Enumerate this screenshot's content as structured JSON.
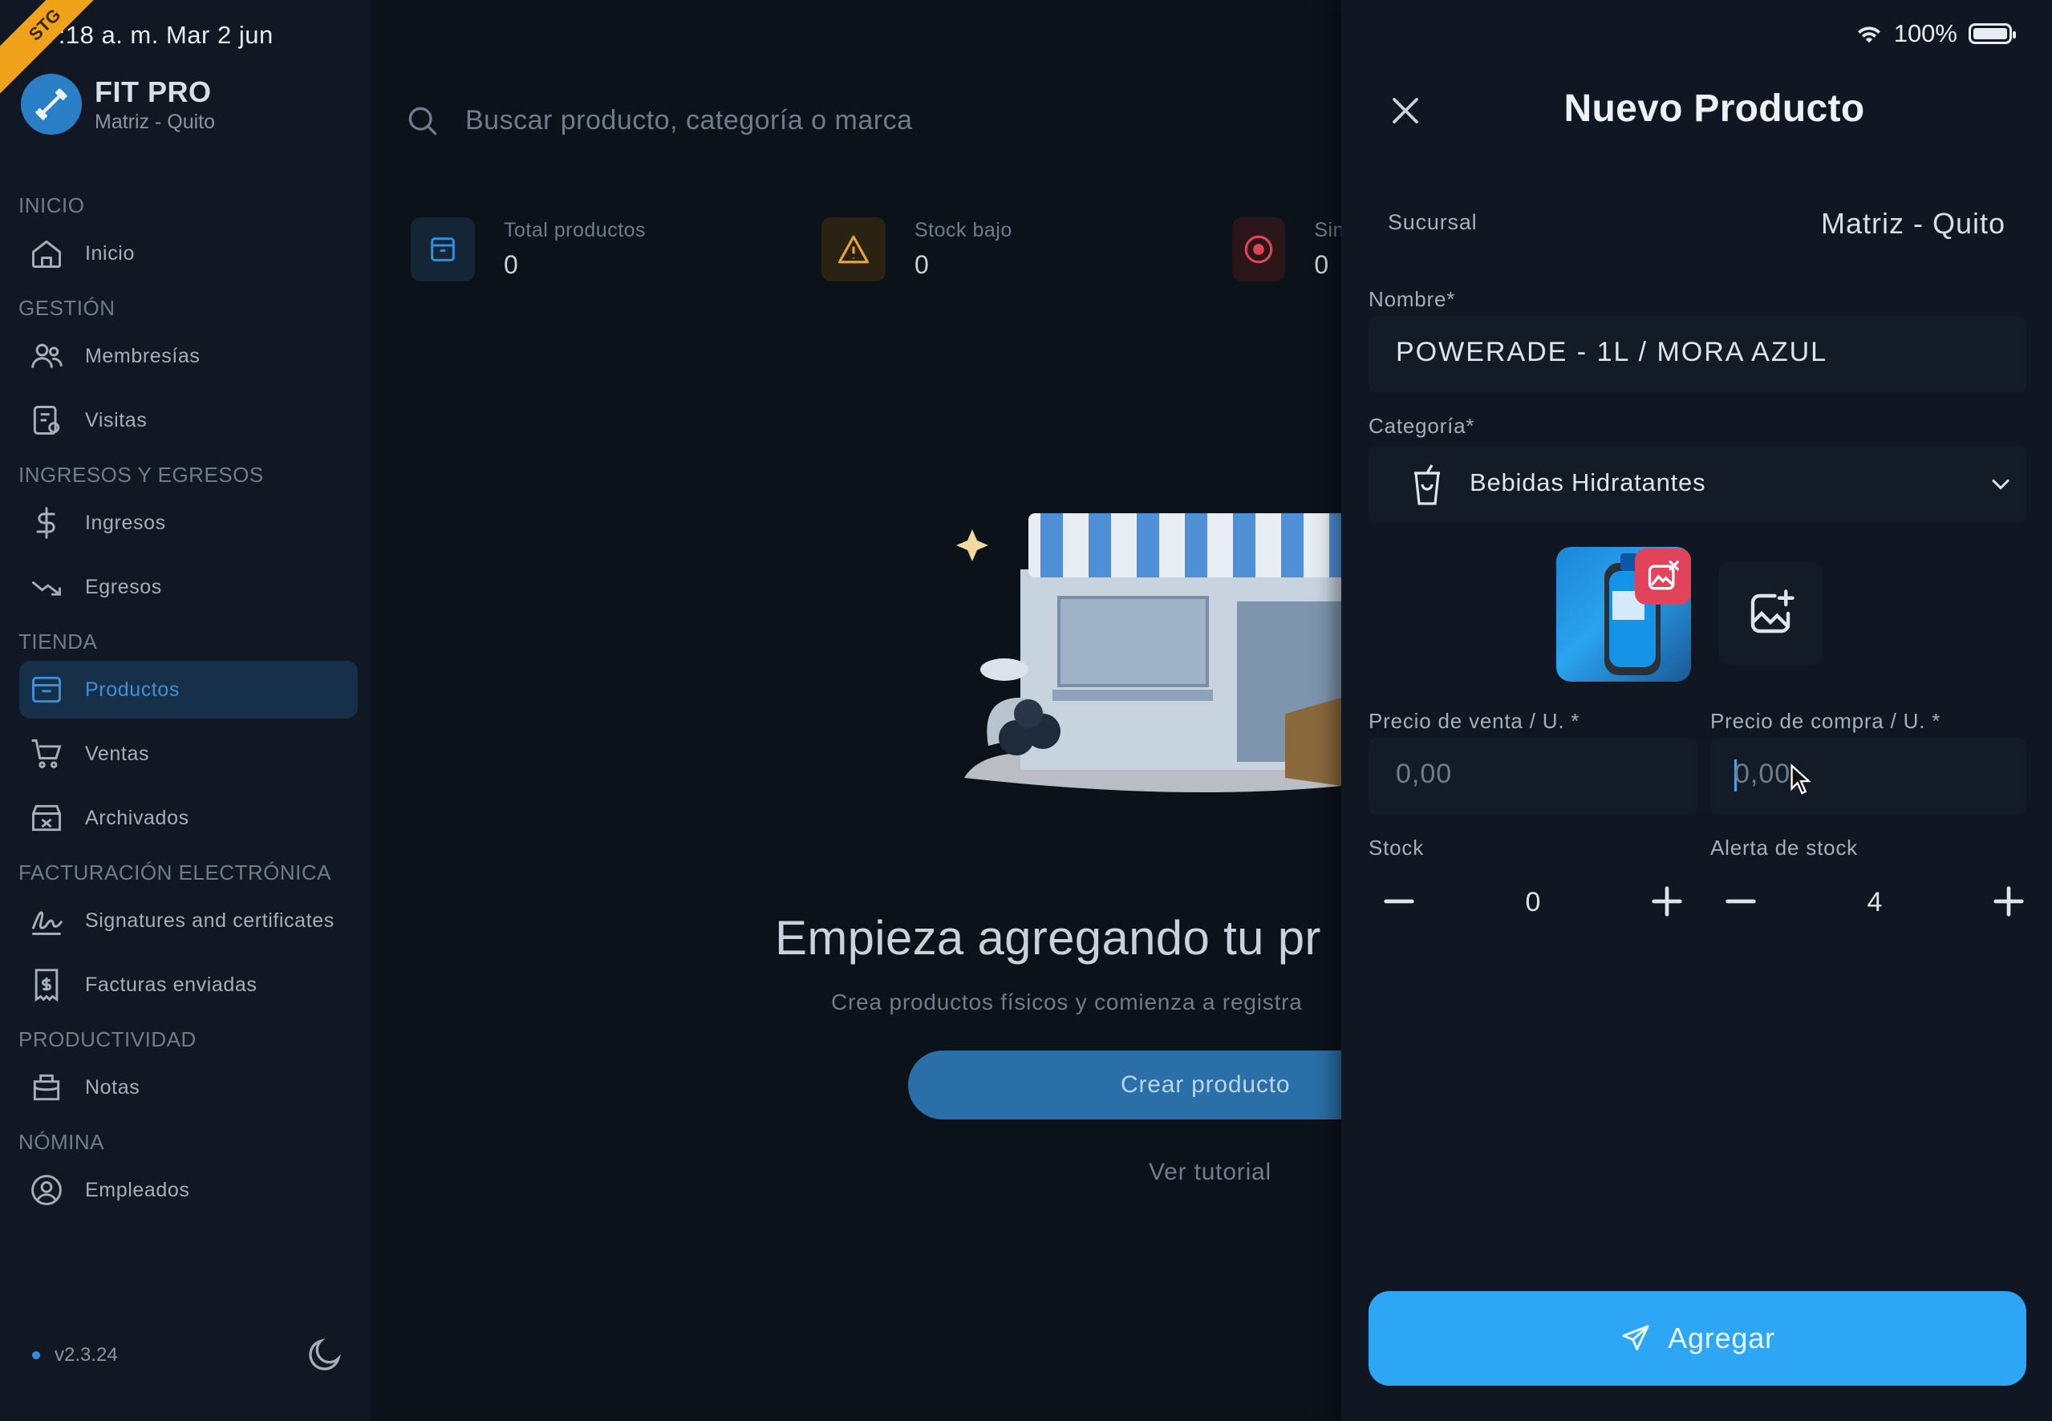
{
  "status_bar": {
    "time": "7:18 a. m.  Mar 2 jun",
    "battery": "100%",
    "ribbon": "STG"
  },
  "brand": {
    "name": "FIT PRO",
    "subtitle": "Matriz - Quito"
  },
  "sidebar": {
    "sections": [
      {
        "title": "INICIO",
        "items": [
          {
            "label": "Inicio",
            "icon": "home-icon"
          }
        ]
      },
      {
        "title": "GESTIÓN",
        "items": [
          {
            "label": "Membresías",
            "icon": "users-icon"
          },
          {
            "label": "Visitas",
            "icon": "visits-icon"
          }
        ]
      },
      {
        "title": "INGRESOS Y EGRESOS",
        "items": [
          {
            "label": "Ingresos",
            "icon": "dollar-icon"
          },
          {
            "label": "Egresos",
            "icon": "trend-down-icon"
          }
        ]
      },
      {
        "title": "TIENDA",
        "items": [
          {
            "label": "Productos",
            "icon": "box-icon",
            "active": true
          },
          {
            "label": "Ventas",
            "icon": "cart-icon"
          },
          {
            "label": "Archivados",
            "icon": "archive-icon"
          }
        ]
      },
      {
        "title": "FACTURACIÓN ELECTRÓNICA",
        "items": [
          {
            "label": "Signatures and certificates",
            "icon": "signature-icon"
          },
          {
            "label": "Facturas enviadas",
            "icon": "invoice-icon"
          }
        ]
      },
      {
        "title": "PRODUCTIVIDAD",
        "items": [
          {
            "label": "Notas",
            "icon": "notes-icon"
          }
        ]
      },
      {
        "title": "NÓMINA",
        "items": [
          {
            "label": "Empleados",
            "icon": "employee-icon"
          }
        ]
      }
    ],
    "version": "v2.3.24"
  },
  "main": {
    "search_placeholder": "Buscar producto, categoría o marca",
    "stats": [
      {
        "label": "Total productos",
        "value": "0",
        "icon": "box-icon",
        "color": "#2f8fe0"
      },
      {
        "label": "Stock bajo",
        "value": "0",
        "icon": "warning-icon",
        "color": "#e6a23c"
      },
      {
        "label": "Sin",
        "value": "0",
        "icon": "alert-circle-icon",
        "color": "#e0435a"
      }
    ],
    "empty_title": "Empieza agregando tu pr",
    "empty_subtitle": "Crea productos físicos y comienza a registra",
    "create_button": "Crear producto",
    "tutorial_link": "Ver tutorial"
  },
  "panel": {
    "title": "Nuevo Producto",
    "branch_label": "Sucursal",
    "branch_value": "Matriz - Quito",
    "name_label": "Nombre*",
    "name_value": "POWERADE - 1L / MORA AZUL",
    "category_label": "Categoría*",
    "category_value": "Bebidas Hidratantes",
    "sale_price_label": "Precio de venta / U. *",
    "sale_price_placeholder": "0,00",
    "purchase_price_label": "Precio de compra / U. *",
    "purchase_price_placeholder": "0,00",
    "stock_label": "Stock",
    "stock_value": "0",
    "alert_label": "Alerta de stock",
    "alert_value": "4",
    "submit_label": "Agregar",
    "accent": "#2da6f5"
  }
}
